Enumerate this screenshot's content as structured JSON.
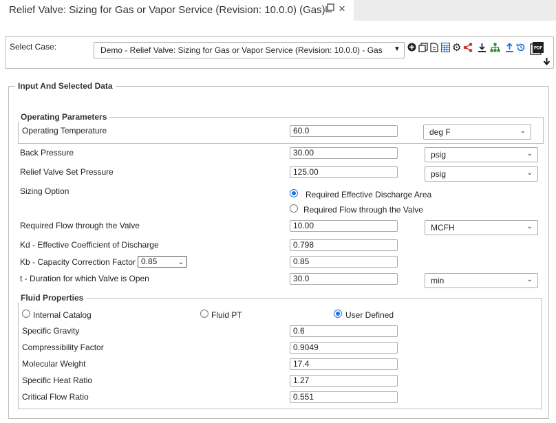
{
  "tab": {
    "title": "Relief Valve: Sizing for Gas or Vapor Service (Revision: 10.0.0) (Gas)",
    "popout_icon": "popout-icon",
    "close_icon": "close-icon"
  },
  "case": {
    "label": "Select Case:",
    "value": "Demo - Relief Valve: Sizing for Gas or Vapor Service (Revision: 10.0.0) - Gas"
  },
  "toolbar": [
    {
      "name": "add-icon",
      "glyph": "⊕",
      "color": "#222222"
    },
    {
      "name": "copy-icon",
      "glyph": "❐",
      "color": "#222222"
    },
    {
      "name": "pdf-file-icon",
      "glyph": "▯",
      "color": "#222222"
    },
    {
      "name": "calculator-icon",
      "glyph": "▦",
      "color": "#1a5fb4"
    },
    {
      "name": "gear-icon",
      "glyph": "⚙",
      "color": "#222222"
    },
    {
      "name": "share-icon",
      "glyph": "⋖",
      "color": "#d62828"
    },
    {
      "name": "download-icon",
      "glyph": "⤓",
      "color": "#222222"
    },
    {
      "name": "hierarchy-icon",
      "glyph": "♣",
      "color": "#2e8b2e"
    },
    {
      "name": "upload-icon",
      "glyph": "⤒",
      "color": "#1a73e8"
    },
    {
      "name": "history-icon",
      "glyph": "↺",
      "color": "#1a73e8"
    },
    {
      "name": "pdf-stack-icon",
      "glyph": "PDF",
      "color": "#222222"
    }
  ],
  "input": {
    "legend": "Input And Selected Data",
    "operating": {
      "legend": "Operating Parameters",
      "temp_label": "Operating Temperature",
      "temp_value": "60.0",
      "temp_unit": "deg F"
    },
    "back_pressure": {
      "label": "Back Pressure",
      "value": "30.00",
      "unit": "psig"
    },
    "set_pressure": {
      "label": "Relief Valve Set Pressure",
      "value": "125.00",
      "unit": "psig"
    },
    "sizing": {
      "label": "Sizing Option",
      "option_area": "Required Effective Discharge Area",
      "option_flow": "Required Flow through the Valve",
      "selected": "area"
    },
    "flow": {
      "label": "Required Flow through the Valve",
      "value": "10.00",
      "unit": "MCFH"
    },
    "kd": {
      "label": "Kd - Effective Coefficient of Discharge",
      "value": "0.798"
    },
    "kb": {
      "label": "Kb - Capacity Correction Factor",
      "select_value": "0.85",
      "value": "0.85"
    },
    "duration": {
      "label": "t - Duration for which Valve is Open",
      "value": "30.0",
      "unit": "min"
    }
  },
  "fluid": {
    "legend": "Fluid Properties",
    "source_internal": "Internal Catalog",
    "source_pt": "Fluid PT",
    "source_user": "User Defined",
    "selected": "user",
    "sg": {
      "label": "Specific Gravity",
      "value": "0.6"
    },
    "z": {
      "label": "Compressibility Factor",
      "value": "0.9049"
    },
    "mw": {
      "label": "Molecular Weight",
      "value": "17.4"
    },
    "k": {
      "label": "Specific Heat Ratio",
      "value": "1.27"
    },
    "cfr": {
      "label": "Critical Flow Ratio",
      "value": "0.551"
    }
  }
}
